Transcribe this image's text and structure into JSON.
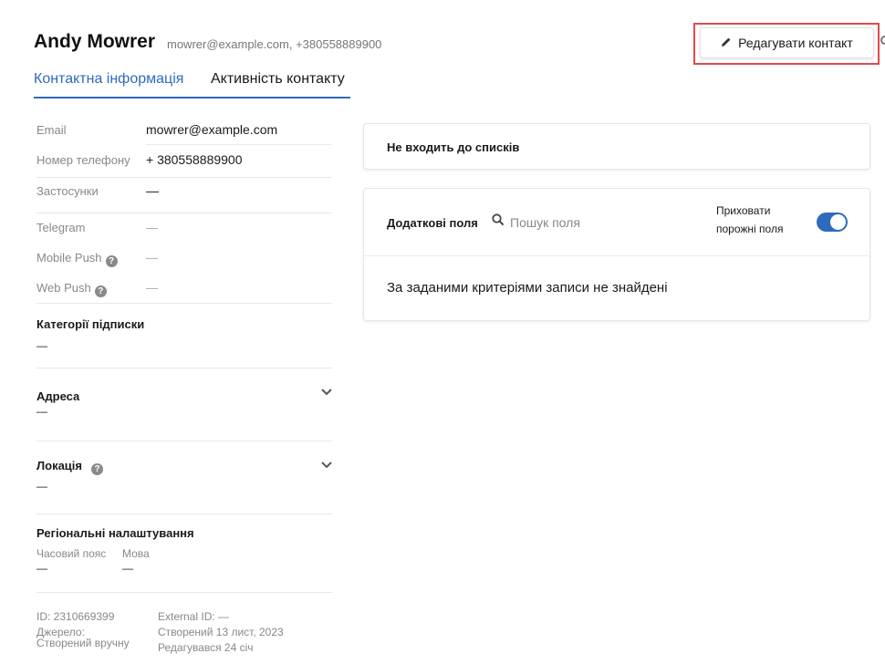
{
  "header": {
    "name": "Andy Mowrer",
    "subtitle": "mowrer@example.com, +380558889900",
    "edit_label": "Редагувати контакт"
  },
  "tabs": [
    {
      "label": "Контактна інформація",
      "active": true
    },
    {
      "label": "Активність контакту",
      "active": false
    }
  ],
  "info": {
    "email_label": "Email",
    "email_value": "mowrer@example.com",
    "phone_label": "Номер телефону",
    "phone_value": "+ 380558889900",
    "apps_label": "Застосунки",
    "apps_value": "—",
    "telegram_label": "Telegram",
    "telegram_value": "—",
    "mobile_push_label": "Mobile Push",
    "mobile_push_value": "—",
    "web_push_label": "Web Push",
    "web_push_value": "—"
  },
  "subscription": {
    "title": "Категорії підписки",
    "value": "—"
  },
  "address": {
    "title": "Адреса",
    "value": "—"
  },
  "location": {
    "title": "Локація",
    "value": "—"
  },
  "regional": {
    "title": "Регіональні налаштування",
    "timezone_label": "Часовий пояс",
    "timezone_value": "—",
    "language_label": "Мова",
    "language_value": "—"
  },
  "meta": {
    "id": "ID: 2310669399",
    "source_label": "Джерело:",
    "source_value": "Створений вручну",
    "external_id": "External ID: —",
    "created": "Створений 13 лист, 2023",
    "edited": "Редагувався 24 січ"
  },
  "lists_card": {
    "text": "Не входить до списків"
  },
  "fields_card": {
    "title": "Додаткові поля",
    "search_placeholder": "Пошук поля",
    "hide_empty_line1": "Приховати",
    "hide_empty_line2": "порожні поля",
    "hide_empty_on": true,
    "empty_message": "За заданими критеріями записи не знайдені"
  },
  "colors": {
    "accent": "#2d6bbd",
    "highlight": "#e04a4a"
  },
  "icons": {
    "edit": "pencil-icon",
    "search": "search-icon",
    "help": "help-icon",
    "expand": "chevron-down-icon"
  }
}
